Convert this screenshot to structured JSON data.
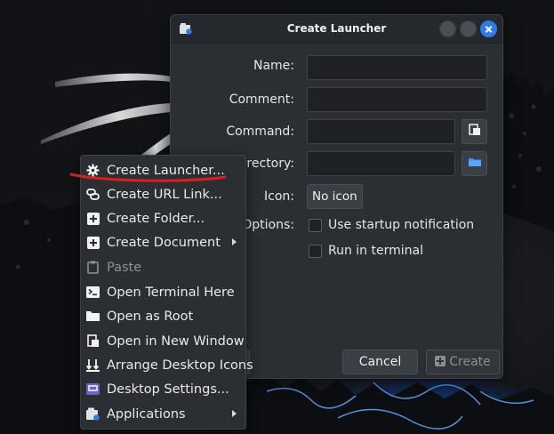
{
  "dialog": {
    "title": "Create Launcher",
    "fields": {
      "name_label": "Name:",
      "comment_label": "Comment:",
      "command_label": "Command:",
      "directory_label": "irectory:",
      "icon_label": "Icon:",
      "options_label": "Options:"
    },
    "values": {
      "name": "",
      "comment": "",
      "command": "",
      "directory": ""
    },
    "icon_button": "No icon",
    "options": {
      "startup_notification": "Use startup notification",
      "run_in_terminal": "Run in terminal"
    },
    "buttons": {
      "cancel": "Cancel",
      "create": "Create"
    }
  },
  "menu": {
    "items": [
      {
        "label": "Create Launcher...",
        "icon": "gear-icon"
      },
      {
        "label": "Create URL Link...",
        "icon": "link-icon"
      },
      {
        "label": "Create Folder...",
        "icon": "add-folder-icon"
      },
      {
        "label": "Create Document",
        "icon": "add-document-icon",
        "submenu": true
      },
      {
        "label": "Paste",
        "icon": "clipboard-icon",
        "disabled": true
      },
      {
        "label": "Open Terminal Here",
        "icon": "terminal-icon"
      },
      {
        "label": "Open as Root",
        "icon": "folder-icon"
      },
      {
        "label": "Open in New Window",
        "icon": "new-window-icon"
      },
      {
        "label": "Arrange Desktop Icons",
        "icon": "arrange-icon"
      },
      {
        "label": "Desktop Settings...",
        "icon": "settings-icon"
      },
      {
        "label": "Applications",
        "icon": "applications-icon",
        "submenu": true
      }
    ]
  },
  "colors": {
    "accent": "#2f7ae5",
    "annotation": "#d42020",
    "surface": "#2b2e33"
  }
}
